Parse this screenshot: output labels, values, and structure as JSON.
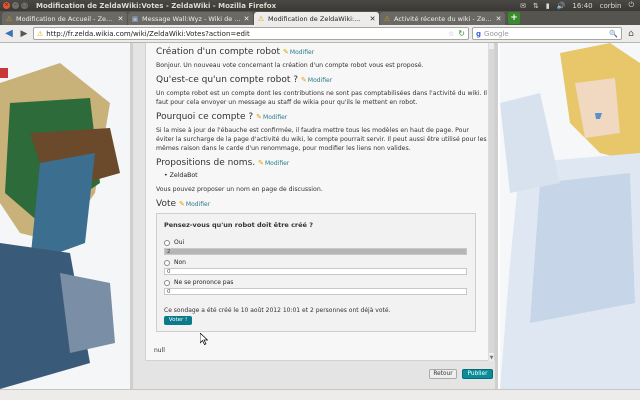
{
  "window": {
    "title": "Modification de ZeldaWiki:Votes - ZeldaWiki - Mozilla Firefox",
    "tray": {
      "mail": "✉",
      "network": "⇅",
      "battery": "▮",
      "volume": "🔊",
      "clock": "16:40",
      "user": "corbin",
      "power": "⏻"
    }
  },
  "tabs": [
    {
      "label": "Modification de Accueil - Ze...",
      "icon": "warning-icon",
      "glyph": "⚠",
      "active": false
    },
    {
      "label": "Message Wall:Wyz - Wiki de ...",
      "icon": "wiki-icon",
      "glyph": "▣",
      "active": false
    },
    {
      "label": "Modification de ZeldaWiki:...",
      "icon": "warning-icon",
      "glyph": "⚠",
      "active": true
    },
    {
      "label": "Activité récente du wiki - Ze...",
      "icon": "warning-icon",
      "glyph": "⚠",
      "active": false
    }
  ],
  "tab_close": "✕",
  "new_tab": "+",
  "nav": {
    "back": "◀",
    "forward": "▶",
    "url_prefix": "⚠",
    "url": "http://fr.zelda.wikia.com/wiki/ZeldaWiki:Votes?action=edit",
    "star": "☆",
    "refresh": "↻",
    "search_placeholder": "Google",
    "search_engine": "g",
    "search_icon": "🔍",
    "home": "⌂"
  },
  "content": {
    "edit_label": "Modifier",
    "edit_glyph": "✎",
    "sections": {
      "s1_title": "Création d'un compte robot",
      "s1_text": "Bonjour. Un nouveau vote concernant la création d'un compte robot vous est proposé.",
      "s2_title": "Qu'est-ce qu'un compte robot ?",
      "s2_text": "Un compte robot est un compte dont les contributions ne sont pas comptabilisées dans l'activité du wiki. Il faut pour cela envoyer un message au staff de wikia pour qu'ils le mettent en robot.",
      "s3_title": "Pourquoi ce compte ?",
      "s3_text": "Si la mise à jour de l'ébauche est confirmée, il faudra mettre tous les modèles en haut de page. Pour éviter la surcharge de la page d'activité du wiki, le compte pourrait servir. Il peut aussi être utilisé pour les mêmes raison dans le carde d'un renommage, pour modifier les liens non valides.",
      "s4_title": "Propositions de noms.",
      "s4_bullet": "ZeldaBot",
      "s4_text": "Vous pouvez proposer un nom en page de discussion.",
      "s5_title": "Vote"
    },
    "poll": {
      "question": "Pensez-vous qu'un robot doit être créé ?",
      "options": [
        {
          "label": "Oui",
          "count": "2",
          "fraction": 1.0
        },
        {
          "label": "Non",
          "count": "0",
          "fraction": 0.0
        },
        {
          "label": "Ne se prononce pas",
          "count": "0",
          "fraction": 0.0
        }
      ],
      "footer": "Ce sondage a été créé le 10 août 2012 10:01 et 2 personnes ont déjà voté.",
      "vote_button": "Voter !"
    },
    "null_text": "null",
    "cancel_button": "Retour",
    "publish_button": "Publier"
  }
}
